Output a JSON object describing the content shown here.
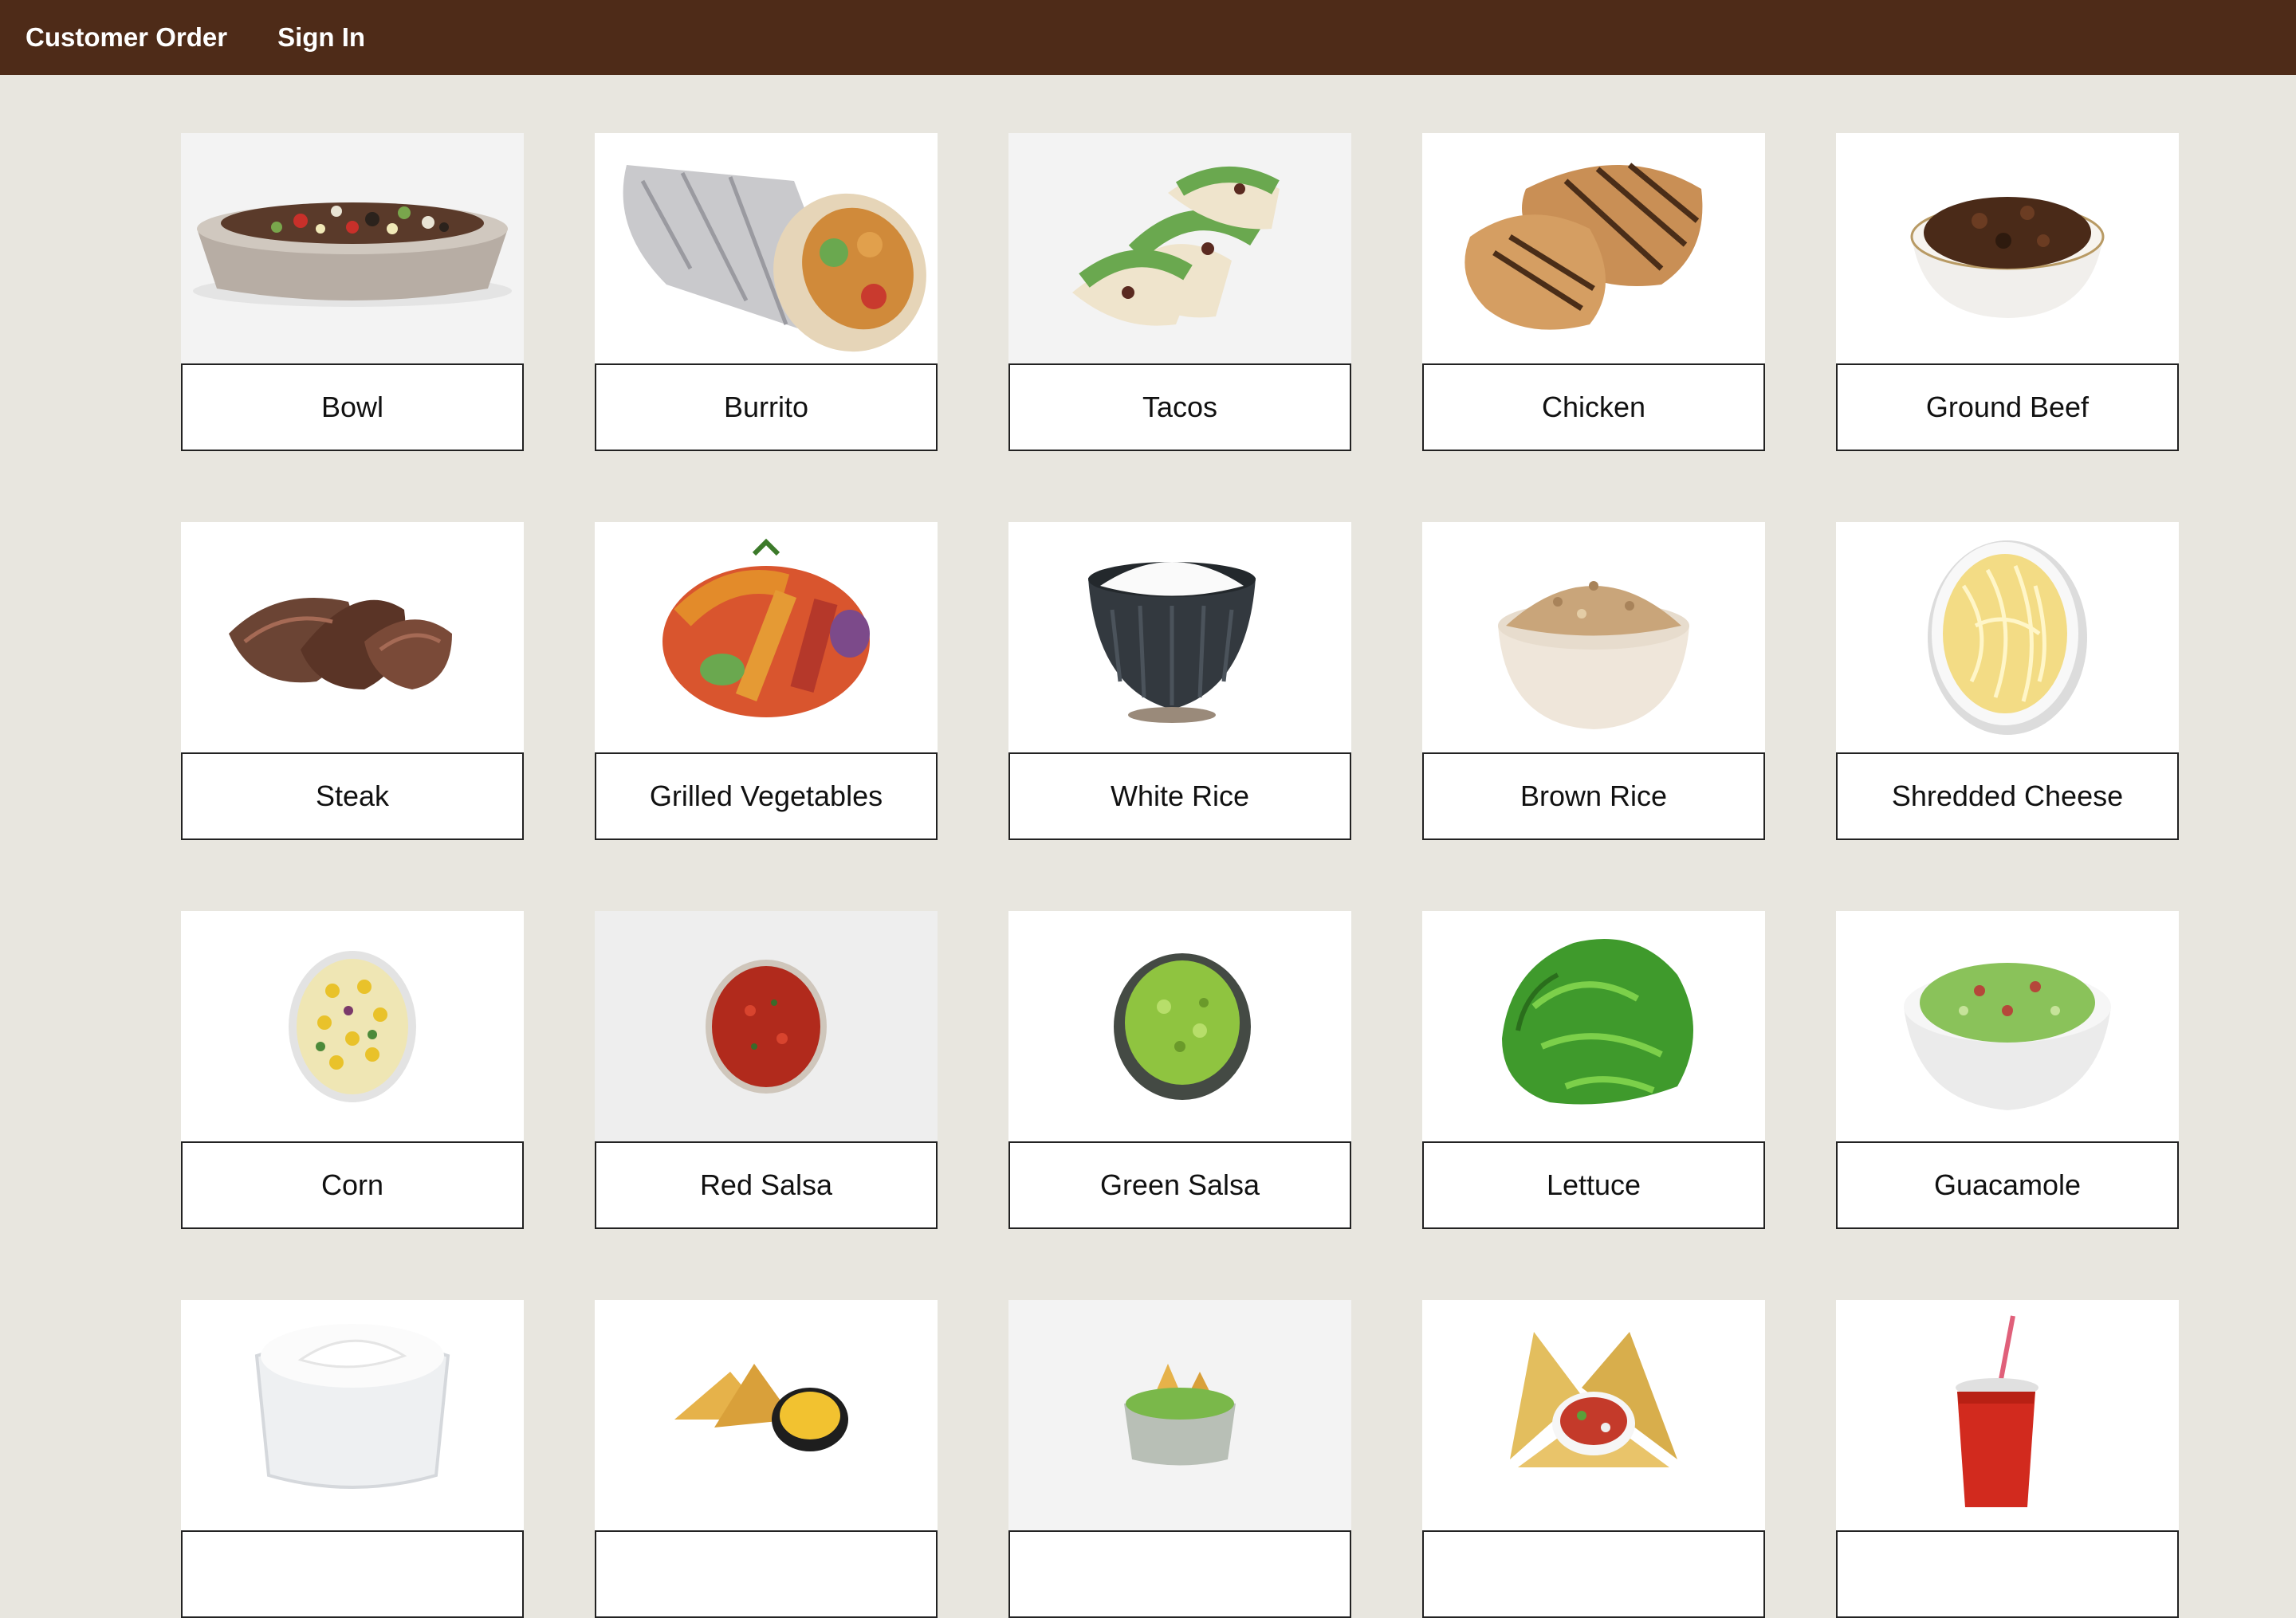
{
  "nav": {
    "brand": "Customer Order",
    "sign_in": "Sign In"
  },
  "colors": {
    "nav_background": "#4e2b18",
    "page_background": "#e8e6df",
    "card_background": "#ffffff",
    "label_border": "#222222"
  },
  "menu": {
    "items": [
      {
        "label": "Bowl",
        "icon": "bowl-icon"
      },
      {
        "label": "Burrito",
        "icon": "burrito-icon"
      },
      {
        "label": "Tacos",
        "icon": "tacos-icon"
      },
      {
        "label": "Chicken",
        "icon": "chicken-icon"
      },
      {
        "label": "Ground Beef",
        "icon": "ground-beef-icon"
      },
      {
        "label": "Steak",
        "icon": "steak-icon"
      },
      {
        "label": "Grilled Vegetables",
        "icon": "grilled-vegetables-icon"
      },
      {
        "label": "White Rice",
        "icon": "white-rice-icon"
      },
      {
        "label": "Brown Rice",
        "icon": "brown-rice-icon"
      },
      {
        "label": "Shredded Cheese",
        "icon": "shredded-cheese-icon"
      },
      {
        "label": "Corn",
        "icon": "corn-icon"
      },
      {
        "label": "Red Salsa",
        "icon": "red-salsa-icon"
      },
      {
        "label": "Green Salsa",
        "icon": "green-salsa-icon"
      },
      {
        "label": "Lettuce",
        "icon": "lettuce-icon"
      },
      {
        "label": "Guacamole",
        "icon": "guacamole-icon"
      },
      {
        "label": "",
        "icon": "sour-cream-icon"
      },
      {
        "label": "",
        "icon": "chips-queso-icon"
      },
      {
        "label": "",
        "icon": "chips-guacamole-icon"
      },
      {
        "label": "",
        "icon": "chips-salsa-icon"
      },
      {
        "label": "",
        "icon": "drink-cup-icon"
      }
    ]
  }
}
